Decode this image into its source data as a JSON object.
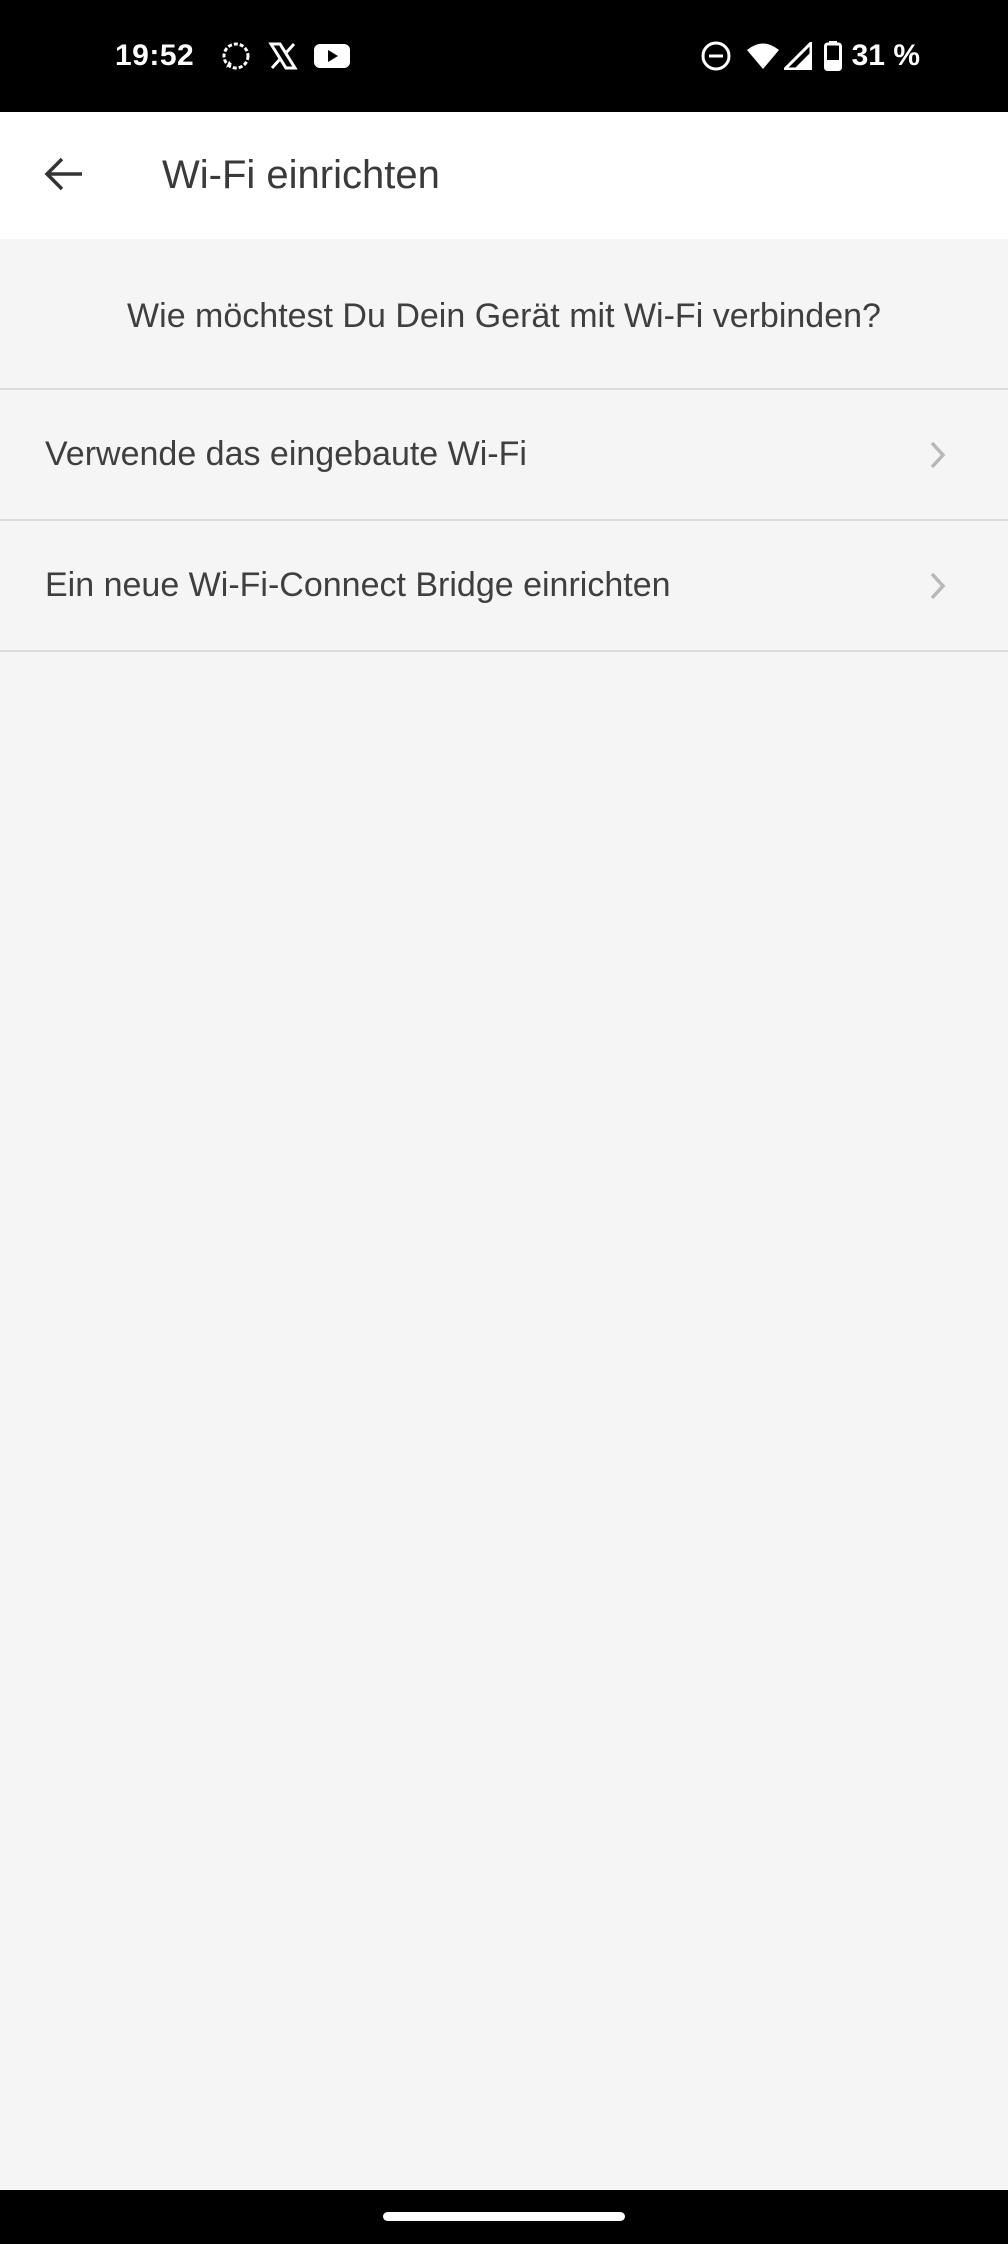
{
  "status_bar": {
    "time": "19:52",
    "battery": "31 %",
    "icons": [
      "signal-app-icon",
      "x-app-icon",
      "youtube-icon",
      "do-not-disturb-icon",
      "wifi-icon",
      "cell-signal-icon",
      "battery-icon"
    ]
  },
  "app_bar": {
    "title": "Wi-Fi einrichten",
    "back_icon": "arrow-back-icon"
  },
  "main": {
    "question": "Wie möchtest Du Dein Gerät mit Wi-Fi verbinden?",
    "options": [
      {
        "label": "Verwende das eingebaute Wi-Fi"
      },
      {
        "label": "Ein neue Wi-Fi-Connect Bridge einrichten"
      }
    ]
  },
  "colors": {
    "background": "#f5f5f5",
    "app_bar": "#ffffff",
    "text": "#3f3f3f",
    "divider": "#dcdcdc",
    "chevron": "#b8b8b8"
  }
}
